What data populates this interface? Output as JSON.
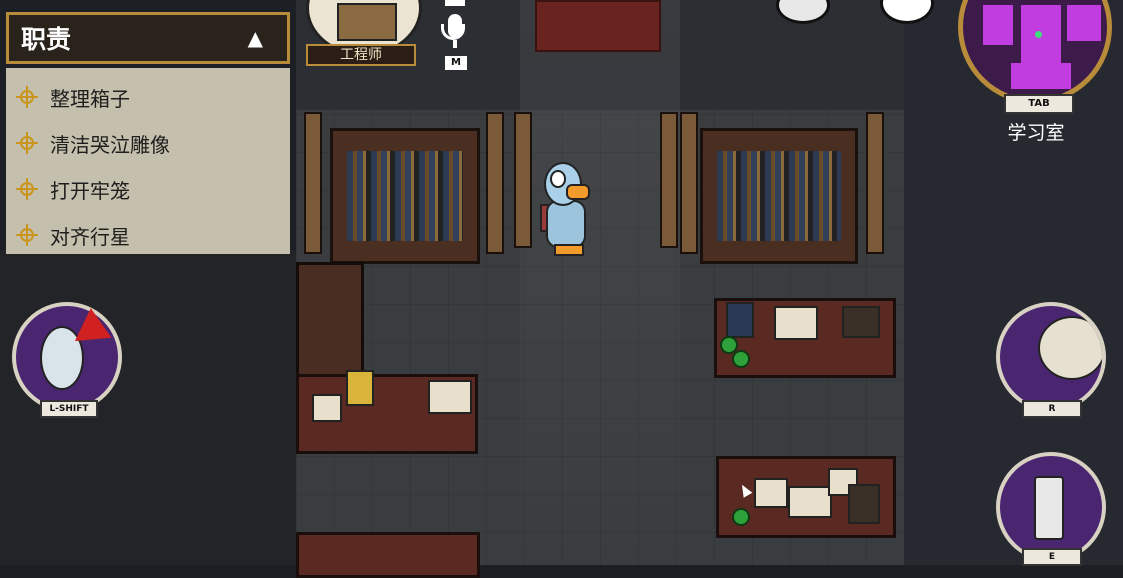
{
  "duties": {
    "title": "职责",
    "caret": "▲",
    "items": [
      {
        "label": "整理箱子"
      },
      {
        "label": "清洁哭泣雕像"
      },
      {
        "label": "打开牢笼"
      },
      {
        "label": "对齐行星"
      }
    ]
  },
  "role": {
    "label": "工程师"
  },
  "voice": {
    "key": "M"
  },
  "minimap": {
    "key": "TAB",
    "room": "学习室"
  },
  "abilities": {
    "left": {
      "key": "L-SHIFT"
    },
    "right_top": {
      "key": "R"
    },
    "right_bottom": {
      "key": "E"
    }
  },
  "colors": {
    "accent": "#b88c3a",
    "duty_panel": "#c5c0ad",
    "ability_bg": "#4a2570",
    "minimap_room": "#c23ddf"
  }
}
